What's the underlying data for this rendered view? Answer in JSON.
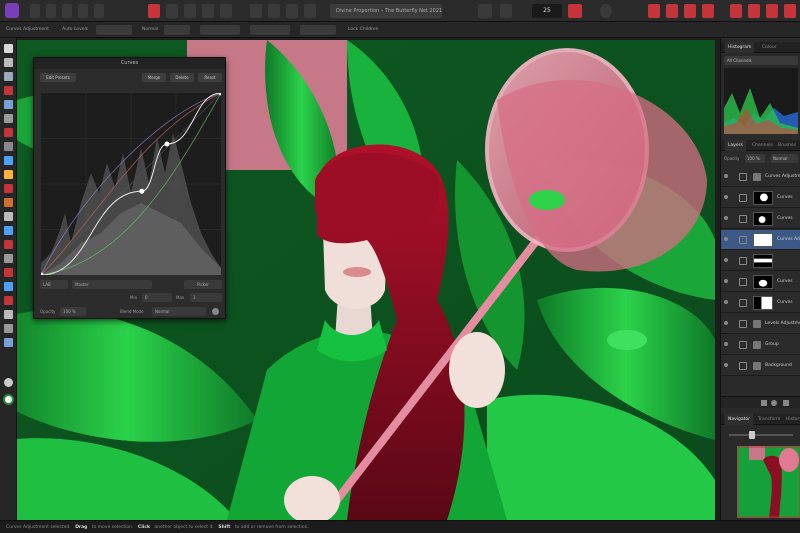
{
  "toolbar": {
    "document_title": "Divine Proportion – The Butterfly Net 2021 6",
    "zoom": "25"
  },
  "context_bar": {
    "layer_label": "Curves Adjustment",
    "mode_label": "Auto Levels",
    "blend_label": "Normal",
    "lock_label": "Lock Children"
  },
  "curves": {
    "title": "Curves",
    "buttons": {
      "edit_presets": "Edit Presets",
      "merge": "Merge",
      "delete": "Delete",
      "reset": "Reset"
    },
    "channel_value": "Master",
    "channel_mode": "LAB",
    "picker_label": "Picker",
    "min_label": "Min",
    "max_label": "Max",
    "min_value": "0",
    "max_value": "1",
    "opacity_label": "Opacity",
    "opacity_value": "100 %",
    "blend_label": "Blend Mode",
    "blend_value": "Normal",
    "curve_points": [
      [
        0,
        0
      ],
      [
        0.56,
        0.46
      ],
      [
        0.7,
        0.72
      ],
      [
        1,
        1
      ]
    ]
  },
  "right_panel": {
    "histogram_tabs": [
      "Histogram",
      "Colour"
    ],
    "channel_select": "All Channels",
    "layers_tabs": [
      "Layers",
      "Channels",
      "Brushes"
    ],
    "opacity_label": "Opacity",
    "opacity_value": "100 %",
    "blend_value": "Normal",
    "layers": [
      {
        "name": "Curves Adjustment",
        "thumb": "none",
        "selected": false
      },
      {
        "name": "Curves",
        "thumb": "mask1",
        "selected": false
      },
      {
        "name": "Curves",
        "thumb": "mask2",
        "selected": false
      },
      {
        "name": "Curves Adjustment",
        "thumb": "white",
        "selected": true
      },
      {
        "name": "",
        "thumb": "mask3",
        "selected": false
      },
      {
        "name": "Curves",
        "thumb": "mask4",
        "selected": false
      },
      {
        "name": "Curves",
        "thumb": "mask5",
        "selected": false
      },
      {
        "name": "Levels Adjustment",
        "thumb": "none",
        "selected": false
      },
      {
        "name": "Group",
        "thumb": "none",
        "selected": false
      },
      {
        "name": "Background",
        "thumb": "none",
        "selected": false
      }
    ],
    "navigator_tabs": [
      "Navigator",
      "Transform",
      "History"
    ]
  },
  "status": {
    "prefix": "Curves Adjustment selected.",
    "drag_key": "Drag",
    "drag_text": "to move selection.",
    "click_key": "Click",
    "click_text": "another object to select it.",
    "shift_key": "Shift",
    "shift_text": "to add or remove from selection."
  },
  "colors": {
    "accent": "#c4343a",
    "selection": "#3c5a85",
    "leaf_green": "#1fb83a",
    "hair_red": "#8a0f22",
    "net_pink": "#e07a91"
  }
}
